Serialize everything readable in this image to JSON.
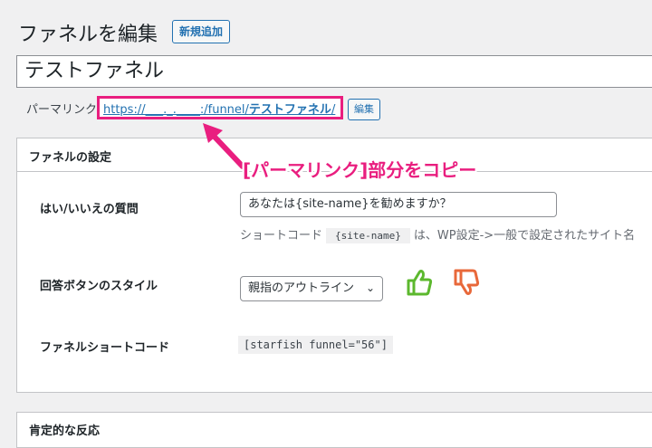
{
  "header": {
    "title": "ファネルを編集",
    "new_button": "新規追加"
  },
  "post": {
    "title_value": "テストファネル",
    "permalink_label": "パーマリンク:",
    "permalink_prefix": "https://___._.____:/funnel/",
    "permalink_slug": "テストファネル",
    "permalink_suffix": "/",
    "edit_button": "編集"
  },
  "annotation": {
    "callout": "[パーマリンク]部分をコピー",
    "color": "#e91e7f"
  },
  "settings_panel": {
    "title": "ファネルの設定",
    "question_label": "はい/いいえの質問",
    "question_value": "あなたは{site-name}を勧めますか？",
    "desc_prefix": "ショートコード",
    "desc_code": "{site-name}",
    "desc_suffix": "は、WP設定->一般で設定されたサイト名",
    "button_style_label": "回答ボタンのスタイル",
    "button_style_value": "親指のアウトライン",
    "thumbs_up_color": "#5cb82e",
    "thumbs_down_color": "#e8683a",
    "shortcode_label": "ファネルショートコード",
    "shortcode_value": "[starfish funnel=\"56\"]"
  },
  "positive_panel": {
    "title": "肯定的な反応"
  },
  "icons": [
    "thumbs-up-outline-icon",
    "thumbs-down-outline-icon",
    "chevron-down-icon"
  ]
}
